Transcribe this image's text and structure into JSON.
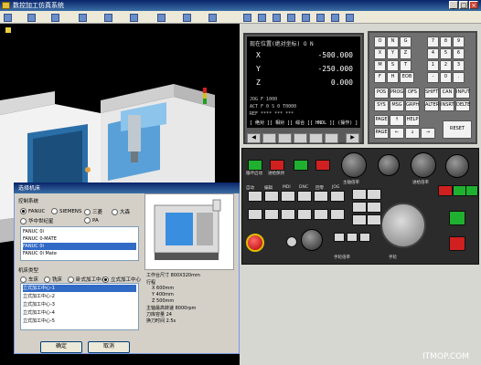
{
  "window": {
    "title": "数控加工仿真系统",
    "min": "_",
    "max": "□",
    "close": "×"
  },
  "menu": {
    "items": [
      "",
      "",
      "",
      "",
      "",
      "",
      "",
      "",
      "",
      "",
      "",
      "",
      "",
      "",
      "",
      "",
      "",
      ""
    ]
  },
  "screen": {
    "header": "现在位置(绝对坐标)  O   N",
    "axes": [
      {
        "axis": "X",
        "value": "-500.000"
      },
      {
        "axis": "Y",
        "value": "-250.000"
      },
      {
        "axis": "Z",
        "value": "0.000"
      }
    ],
    "status1": "JOG  F 1000",
    "status2": "ACT   F  0    S  0   T0000",
    "status3": "REF **** *** ***",
    "status4": "[ 绝对 ][ 相对 ][ 综合 ][ HNDL ][ (操作) ]",
    "softkeys": [
      "◀",
      "",
      "",
      "",
      "",
      "",
      "▶"
    ]
  },
  "keypad": {
    "keys": [
      "O",
      "N",
      "G",
      "7",
      "8",
      "9",
      "X",
      "Y",
      "Z",
      "4",
      "5",
      "6",
      "M",
      "S",
      "T",
      "1",
      "2",
      "3",
      "F",
      "H",
      "EOB",
      "-",
      "0",
      ".",
      "POS",
      "PROG",
      "OFS",
      "SHIFT",
      "CAN",
      "INPUT",
      "SYS",
      "MSG",
      "GRPH",
      "ALTER",
      "INSRT",
      "DELTE",
      "PAGE",
      "↑",
      "HELP",
      "PAGE",
      "←",
      "↓",
      "→",
      "RESET"
    ]
  },
  "operator_panel": {
    "labels": [
      "循环启动",
      "进给保持",
      "自动",
      "编辑",
      "MDI",
      "DNC",
      "回零",
      "JOG",
      "手轮",
      "主轴倍率",
      "进给倍率",
      "手轮倍率"
    ]
  },
  "dialog": {
    "title": "选择机床",
    "group_control": "控制系统",
    "control_options": [
      "FANUC",
      "SIEMENS",
      "三菱",
      "大森",
      "华中世纪星",
      "PA"
    ],
    "control_selected": 0,
    "list_title": "FANUC",
    "systems": [
      "FANUC 0i",
      "FANUC 0-MATE",
      "FANUC 0i",
      "FANUC 0i Mate"
    ],
    "systems_selected": 2,
    "group_type": "机床类型",
    "type_options": [
      "车床",
      "铣床",
      "卧式加工中心",
      "立式加工中心"
    ],
    "type_selected": 3,
    "machines": [
      "立式加工中心-1",
      "立式加工中心-2",
      "立式加工中心-3",
      "立式加工中心-4",
      "立式加工中心-5"
    ],
    "machines_selected": 0,
    "specs": [
      "工作台尺寸  800X320mm",
      "行程",
      "X  600mm",
      "Y  400mm",
      "Z  500mm",
      "主轴最高转速  8000rpm",
      "刀库容量  24",
      "换刀时间  2.5s"
    ],
    "ok": "确定",
    "cancel": "取消"
  },
  "watermark": "ITMOP.COM"
}
